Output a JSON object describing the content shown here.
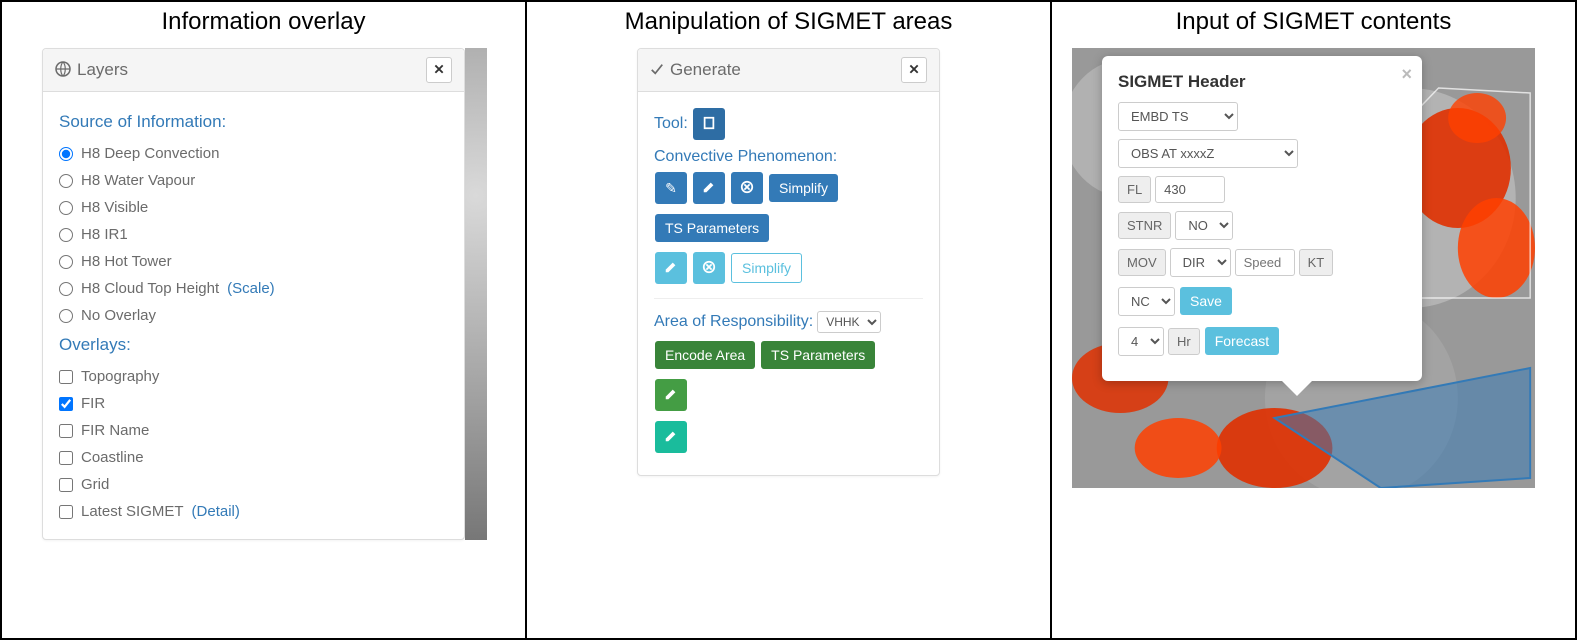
{
  "columns": {
    "c1": "Information overlay",
    "c2": "Manipulation of SIGMET areas",
    "c3": "Input of SIGMET contents"
  },
  "layers_panel": {
    "title": "Layers",
    "source_head": "Source of Information:",
    "sources": [
      "H8 Deep Convection",
      "H8 Water Vapour",
      "H8 Visible",
      "H8 IR1",
      "H8 Hot Tower",
      "H8 Cloud Top Height",
      "No Overlay"
    ],
    "source_scale_link": "(Scale)",
    "overlays_head": "Overlays:",
    "overlays": [
      "Topography",
      "FIR",
      "FIR Name",
      "Coastline",
      "Grid",
      "Latest SIGMET"
    ],
    "overlay_detail_link": "(Detail)"
  },
  "generate_panel": {
    "title": "Generate",
    "tool_label": "Tool:",
    "conv_label": "Convective Phenomenon:",
    "simplify": "Simplify",
    "ts_params": "TS Parameters",
    "aor_label": "Area of Responsibility:",
    "aor_value": "VHHK",
    "encode_area": "Encode Area"
  },
  "sigmet_header": {
    "title": "SIGMET Header",
    "phenom": "EMBD TS",
    "obs": "OBS AT xxxxZ",
    "fl_label": "FL",
    "fl_value": "430",
    "stnr_label": "STNR",
    "stnr_value": "NO",
    "mov_label": "MOV",
    "dir_value": "DIR",
    "speed_placeholder": "Speed",
    "kt_label": "KT",
    "chg_value": "NC",
    "save": "Save",
    "hours_value": "4",
    "hr_label": "Hr",
    "forecast": "Forecast"
  }
}
